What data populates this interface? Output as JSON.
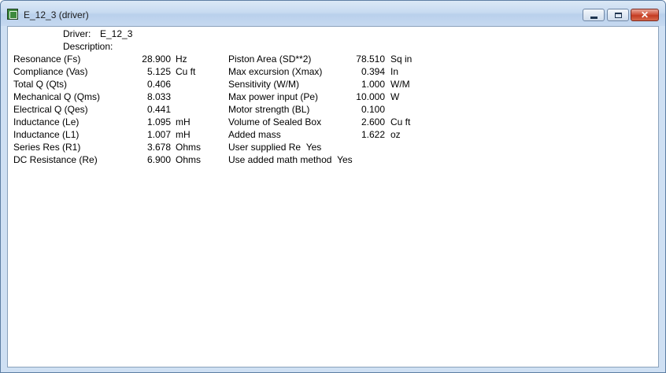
{
  "window": {
    "title": "E_12_3 (driver)"
  },
  "header": {
    "driver_label": "Driver:",
    "driver_value": "E_12_3",
    "description_label": "Description:"
  },
  "left_params": [
    {
      "label": "Resonance (Fs)",
      "value": "28.900",
      "unit": "Hz"
    },
    {
      "label": "Compliance (Vas)",
      "value": "5.125",
      "unit": "Cu ft"
    },
    {
      "label": "Total Q (Qts)",
      "value": "0.406",
      "unit": ""
    },
    {
      "label": "Mechanical Q (Qms)",
      "value": "8.033",
      "unit": ""
    },
    {
      "label": "Electrical Q (Qes)",
      "value": "0.441",
      "unit": ""
    },
    {
      "label": "Inductance (Le)",
      "value": "1.095",
      "unit": "mH"
    },
    {
      "label": "Inductance (L1)",
      "value": "1.007",
      "unit": "mH"
    },
    {
      "label": "Series Res (R1)",
      "value": "3.678",
      "unit": "Ohms"
    },
    {
      "label": "DC Resistance (Re)",
      "value": "6.900",
      "unit": "Ohms"
    }
  ],
  "right_params": [
    {
      "label": "Piston Area (SD**2)",
      "value": "78.510",
      "unit": "Sq in"
    },
    {
      "label": "Max excursion (Xmax)",
      "value": "0.394",
      "unit": "In"
    },
    {
      "label": "Sensitivity (W/M)",
      "value": "1.000",
      "unit": "W/M"
    },
    {
      "label": "Max power input (Pe)",
      "value": "10.000",
      "unit": "W"
    },
    {
      "label": "Motor strength (BL)",
      "value": "0.100",
      "unit": ""
    },
    {
      "label": "Volume of Sealed Box",
      "value": "2.600",
      "unit": "Cu ft"
    },
    {
      "label": "Added mass",
      "value": "1.622",
      "unit": "oz"
    }
  ],
  "flags": [
    {
      "label": "User supplied Re",
      "value": "Yes"
    },
    {
      "label": "Use added math method",
      "value": "Yes"
    }
  ]
}
